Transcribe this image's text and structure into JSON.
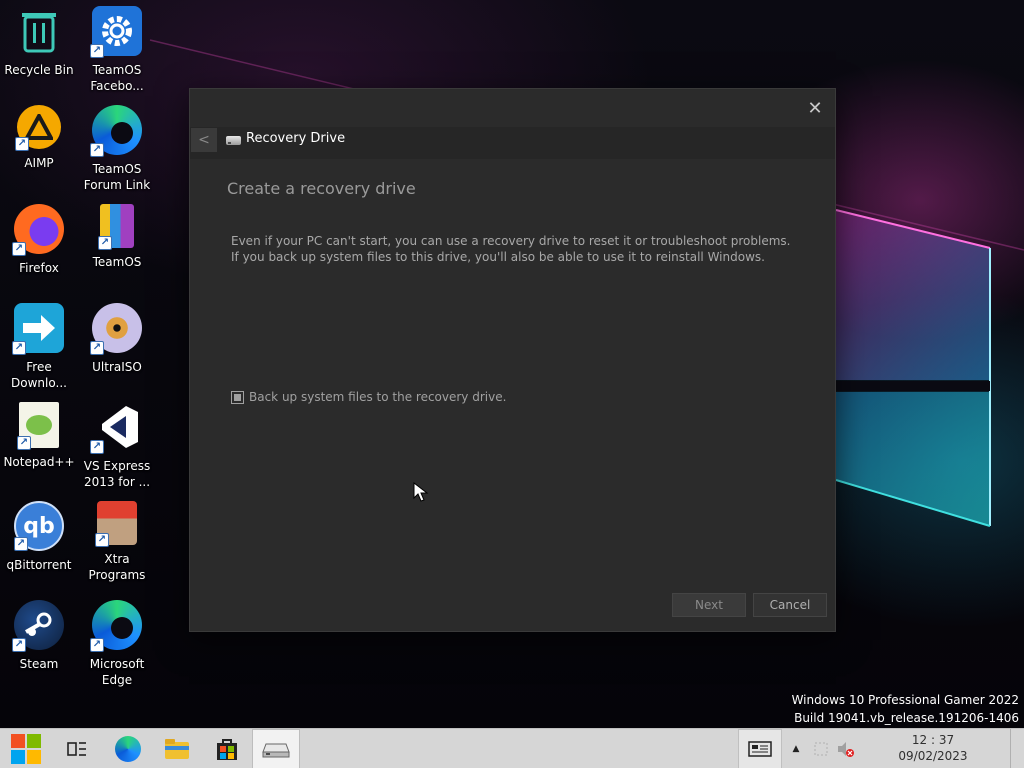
{
  "desktop": {
    "icons": [
      {
        "label": "Recycle Bin",
        "icon": "recycle-bin-icon",
        "shortcut": false
      },
      {
        "label": "TeamOS Facebo...",
        "icon": "gear-icon",
        "shortcut": true
      },
      {
        "label": "AIMP",
        "icon": "aimp-icon",
        "shortcut": true
      },
      {
        "label": "TeamOS Forum Link",
        "icon": "edge-icon",
        "shortcut": true
      },
      {
        "label": "Firefox",
        "icon": "firefox-icon",
        "shortcut": true
      },
      {
        "label": "TeamOS",
        "icon": "teamos-icon",
        "shortcut": true
      },
      {
        "label": "Free Downlo...",
        "icon": "free-download-icon",
        "shortcut": true
      },
      {
        "label": "UltraISO",
        "icon": "ultraiso-disc-icon",
        "shortcut": true
      },
      {
        "label": "Notepad++",
        "icon": "notepad-plus-plus-icon",
        "shortcut": true
      },
      {
        "label": "VS Express 2013 for ...",
        "icon": "visual-studio-icon",
        "shortcut": true
      },
      {
        "label": "qBittorrent",
        "icon": "qbittorrent-icon",
        "shortcut": true
      },
      {
        "label": "Xtra Programs",
        "icon": "xtra-programs-icon",
        "shortcut": true
      },
      {
        "label": "Steam",
        "icon": "steam-icon",
        "shortcut": true
      },
      {
        "label": "Microsoft Edge",
        "icon": "edge-icon",
        "shortcut": true
      }
    ]
  },
  "dialog": {
    "close_glyph": "✕",
    "back_glyph": "<",
    "nav_title": "Recovery Drive",
    "heading": "Create a recovery drive",
    "description_line1": "Even if your PC can't start, you can use a recovery drive to reset it or troubleshoot problems.",
    "description_line2": "If you back up system files to this drive, you'll also be able to use it to reinstall Windows.",
    "checkbox_label": "Back up system files to the recovery drive.",
    "checkbox_checked": true,
    "next_label": "Next",
    "cancel_label": "Cancel"
  },
  "watermark": {
    "line1": "Windows 10 Professional Gamer 2022",
    "line2": "Build 19041.vb_release.191206-1406"
  },
  "taskbar": {
    "items": [
      "windows-start-icon",
      "task-view-icon",
      "edge-icon",
      "file-explorer-icon",
      "store-icon",
      "recovery-drive-icon"
    ],
    "tray_icons": [
      "chevron-up-icon",
      "keyboard-icon",
      "network-icon",
      "volume-muted-icon"
    ],
    "clock_time": "12 : 37",
    "clock_date": "09/02/2023"
  },
  "colors": {
    "dialog_bg": "#2b2b2b",
    "taskbar_bg": "#d6d6d6",
    "accent_pink": "#e040b0",
    "accent_cyan": "#30c0e0"
  }
}
